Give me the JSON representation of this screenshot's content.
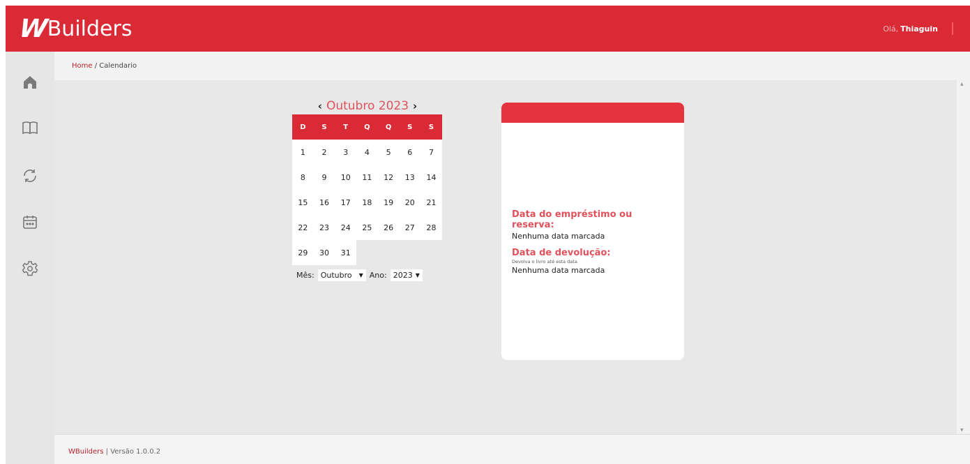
{
  "header": {
    "logo_mark": "W",
    "logo_text": "Builders",
    "greeting": "Olá,",
    "username": "Thiaguin"
  },
  "sidebar": {
    "icons": [
      "home-icon",
      "book-icon",
      "refresh-icon",
      "calendar-icon",
      "gear-icon"
    ]
  },
  "breadcrumb": {
    "home": "Home",
    "separator": " / ",
    "current": "Calendario"
  },
  "calendar": {
    "title": "Outubro 2023",
    "prev": "‹",
    "next": "›",
    "weekdays": [
      "D",
      "S",
      "T",
      "Q",
      "Q",
      "S",
      "S"
    ],
    "weeks": [
      [
        "1",
        "2",
        "3",
        "4",
        "5",
        "6",
        "7"
      ],
      [
        "8",
        "9",
        "10",
        "11",
        "12",
        "13",
        "14"
      ],
      [
        "15",
        "16",
        "17",
        "18",
        "19",
        "20",
        "21"
      ],
      [
        "22",
        "23",
        "24",
        "25",
        "26",
        "27",
        "28"
      ],
      [
        "29",
        "30",
        "31",
        "",
        "",
        "",
        ""
      ]
    ],
    "month_label": "Mês:",
    "month_value": "Outubro",
    "year_label": "Ano:",
    "year_value": "2023"
  },
  "info_card": {
    "loan_label": "Data do empréstimo ou reserva:",
    "loan_value": "Nenhuma data marcada",
    "return_label": "Data de devolução:",
    "return_hint": "Devolva o livro até esta data",
    "return_value": "Nenhuma data marcada"
  },
  "footer": {
    "brand": "WBuilders",
    "version": " | Versão 1.0.0.2"
  },
  "colors": {
    "accent": "#da2a36",
    "accent_text": "#e0525b"
  }
}
